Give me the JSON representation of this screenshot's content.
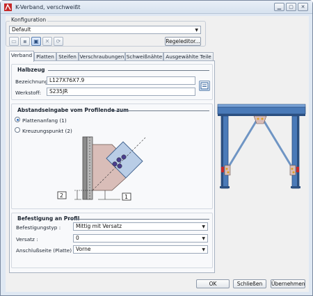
{
  "window": {
    "title": "K-Verband, verschweißt"
  },
  "konfiguration": {
    "group_label": "Konfiguration",
    "selected": "Default",
    "regeleditor_label": "Regeleditor..."
  },
  "tabs": [
    {
      "label": "Verband",
      "active": true
    },
    {
      "label": "Platten",
      "active": false
    },
    {
      "label": "Steifen",
      "active": false
    },
    {
      "label": "Verschraubungen",
      "active": false
    },
    {
      "label": "Schweißnähte",
      "active": false
    },
    {
      "label": "Ausgewählte Teile",
      "active": false
    }
  ],
  "halbzeug": {
    "title": "Halbzeug",
    "bezeichnung_label": "Bezeichnung:",
    "bezeichnung_value": "L127X76X7.9",
    "werkstoff_label": "Werkstoff:",
    "werkstoff_value": "S235JR"
  },
  "abstand": {
    "title": "Abstandseingabe vom Profilende zum",
    "option1": "Plattenanfang (1)",
    "option2": "Kreuzungspunkt (2)",
    "selected": "option1",
    "marker1": "1",
    "marker2": "2"
  },
  "befestigung": {
    "title": "Befestigung an Profil",
    "typ_label": "Befestigungstyp :",
    "typ_value": "Mittig mit Versatz",
    "versatz_label": "Versatz :",
    "versatz_value": "0",
    "anschluss_label": "Anschlußseite (Platte) :",
    "anschluss_value": "Vorne"
  },
  "footer": {
    "ok": "OK",
    "schliessen": "Schließen",
    "uebernehmen": "Übernehmen"
  },
  "colors": {
    "steel_blue": "#4a7ab8",
    "steel_dark": "#2b4f80",
    "plate_pink": "#d9bdb8",
    "accent_blue": "#2f6fc0"
  }
}
